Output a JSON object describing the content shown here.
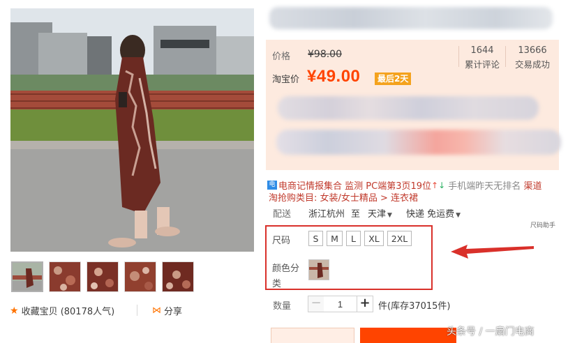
{
  "gallery": {
    "thumbnails": [
      "thumb-1",
      "thumb-2",
      "thumb-3",
      "thumb-4",
      "thumb-5"
    ]
  },
  "actions": {
    "favorite_label": "收藏宝贝 (80178人气)",
    "share_label": "分享",
    "favorite_icon": "star-icon",
    "share_icon": "share-icon"
  },
  "price": {
    "label": "价格",
    "original": "¥98.00",
    "taobao_label": "淘宝价",
    "current": "¥49.00",
    "promo_tag": "最后2天"
  },
  "stats": {
    "reviews_count": "1644",
    "reviews_label": "累计评论",
    "sales_count": "13666",
    "sales_label": "交易成功"
  },
  "tool_bar": {
    "icon_text": "电",
    "intro": "电商记情报集合 监测",
    "pc_rank": "PC端第3页19位",
    "up_arrow": "↑",
    "down_arrow": "↓",
    "mobile_rank": "手机端昨天无排名",
    "channel": "渠道",
    "category": "淘抢购类目:  女装/女士精品 > 连衣裙"
  },
  "shipping": {
    "label": "配送",
    "from": "浙江杭州",
    "to_word": "至",
    "destination": "天津",
    "method": "快递 免运费"
  },
  "assistant_note": "尺码助手",
  "sku": {
    "size_label": "尺码",
    "sizes": [
      "S",
      "M",
      "L",
      "XL",
      "2XL"
    ],
    "color_label": "颜色分类"
  },
  "quantity": {
    "label": "数量",
    "minus": "−",
    "value": "1",
    "plus": "+",
    "stock": "件(库存37015件)"
  },
  "watermark": "头条号 / 一扇门电商",
  "colors": {
    "accent": "#ff4400",
    "price_panel": "#fdeadf",
    "promo": "#f4a21d",
    "highlight_box": "#d9302a"
  }
}
